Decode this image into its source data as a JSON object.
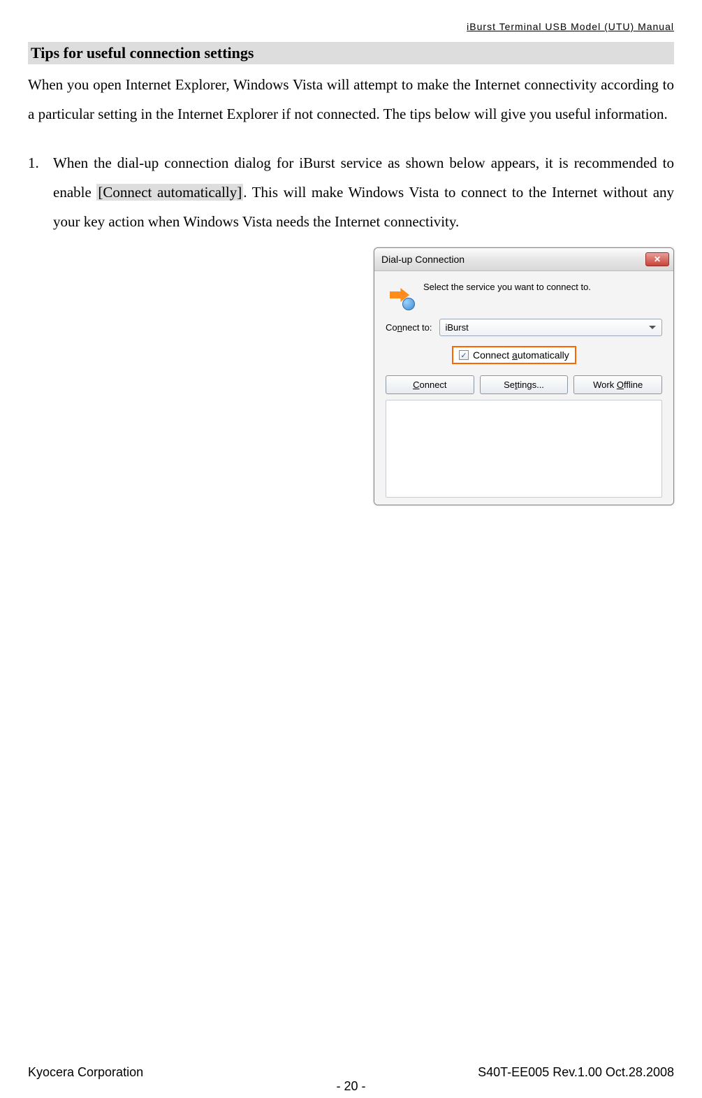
{
  "header": {
    "doc_title": "iBurst  Terminal  USB  Model  (UTU)  Manual"
  },
  "section": {
    "heading": "Tips for useful connection settings",
    "intro": "When you open Internet Explorer, Windows Vista will attempt to make the Internet connectivity according to a particular setting in the Internet Explorer if not connected.   The tips below will give you useful information.",
    "item_num": "1.",
    "item_pre": "When the dial-up connection dialog for iBurst service as shown below appears, it is recommended to enable ",
    "item_hl": "[Connect automatically]",
    "item_post": ".   This will make Windows Vista to connect to the Internet without any your key action when Windows Vista needs the Internet connectivity."
  },
  "dialog": {
    "title": "Dial-up Connection",
    "close": "✕",
    "prompt": "Select the service you want to connect to.",
    "connect_to_label": "Connect to:",
    "select_value": "iBurst",
    "checkbox_checked": "✓",
    "checkbox_pre": "Connect ",
    "checkbox_u": "a",
    "checkbox_post": "utomatically",
    "btn_connect_u": "C",
    "btn_connect_rest": "onnect",
    "btn_settings_pre": "Se",
    "btn_settings_u": "t",
    "btn_settings_post": "tings...",
    "btn_offline_pre": "Work ",
    "btn_offline_u": "O",
    "btn_offline_post": "ffline"
  },
  "footer": {
    "left": "Kyocera Corporation",
    "right": "S40T-EE005 Rev.1.00 Oct.28.2008",
    "page": "- 20 -"
  }
}
